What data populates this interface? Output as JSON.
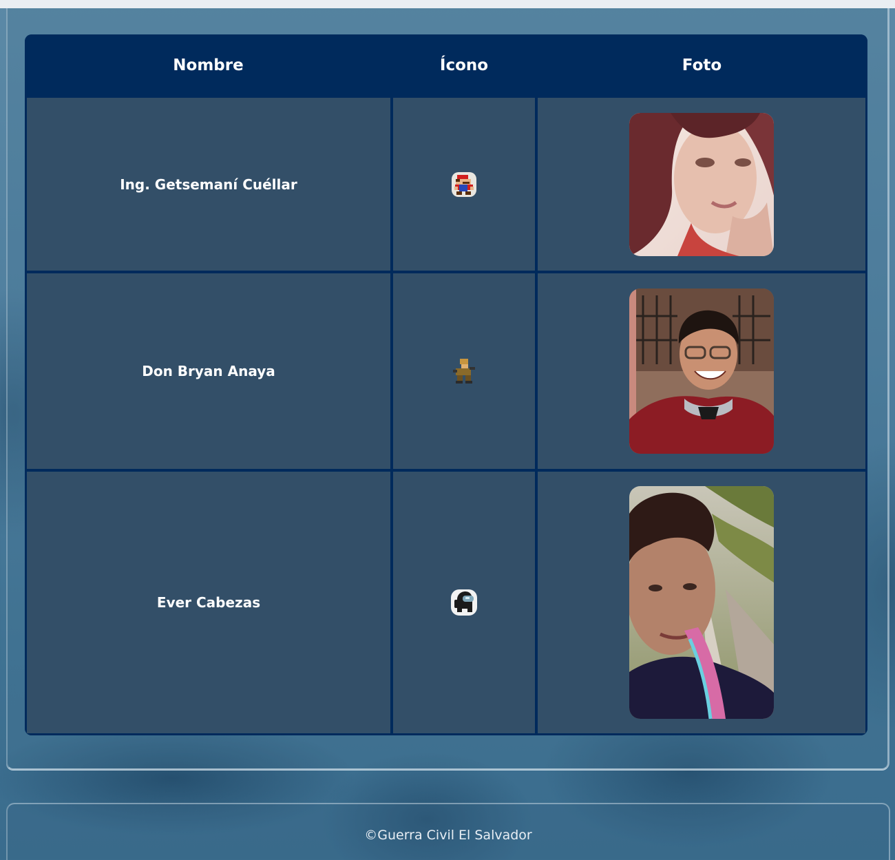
{
  "table": {
    "headers": {
      "name": "Nombre",
      "icon": "Ícono",
      "photo": "Foto"
    },
    "rows": [
      {
        "name": "Ing. Getsemaní Cuéllar",
        "icon": "mario-sprite-icon",
        "photo": "portrait-photo"
      },
      {
        "name": "Don Bryan Anaya",
        "icon": "soldier-sprite-icon",
        "photo": "portrait-photo"
      },
      {
        "name": "Ever Cabezas",
        "icon": "crewmate-sprite-icon",
        "photo": "portrait-photo"
      }
    ]
  },
  "footer": {
    "text": "©Guerra Civil El Salvador"
  },
  "colors": {
    "header_bg": "#002a5c",
    "cell_bg": "#334f68",
    "page_bg": "#4f7f9f"
  }
}
